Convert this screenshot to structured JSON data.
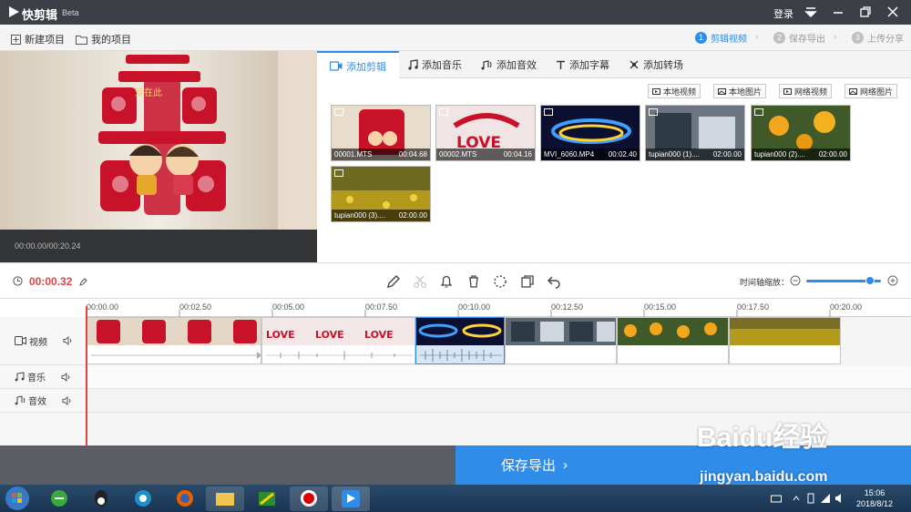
{
  "app": {
    "title": "快剪辑",
    "badge": "Beta",
    "login": "登录"
  },
  "toolbar": {
    "new_project": "新建项目",
    "my_projects": "我的项目"
  },
  "steps": [
    {
      "num": "1",
      "label": "剪辑视频"
    },
    {
      "num": "2",
      "label": "保存导出"
    },
    {
      "num": "3",
      "label": "上传分享"
    }
  ],
  "preview": {
    "time": "00:00.00/00:20.24"
  },
  "tabs": [
    {
      "label": "添加剪辑",
      "icon": "video-icon"
    },
    {
      "label": "添加音乐",
      "icon": "music-icon"
    },
    {
      "label": "添加音效",
      "icon": "sound-effect-icon"
    },
    {
      "label": "添加字幕",
      "icon": "text-icon"
    },
    {
      "label": "添加转场",
      "icon": "transition-icon"
    }
  ],
  "sources": [
    "本地视频",
    "本地图片",
    "网络视频",
    "网络图片"
  ],
  "media": [
    {
      "name": "00001.MTS",
      "duration": "00:04.68"
    },
    {
      "name": "00002.MTS",
      "duration": "00:04.16"
    },
    {
      "name": "MVI_6060.MP4",
      "duration": "00:02.40"
    },
    {
      "name": "tupian000 (1)....",
      "duration": "02:00.00"
    },
    {
      "name": "tupian000 (2)....",
      "duration": "02:00.00"
    },
    {
      "name": "tupian000 (3)....",
      "duration": "02:00.00"
    }
  ],
  "editbar": {
    "current_time": "00:00.32",
    "zoom_label": "时间轴缩放：",
    "zoom_level": 0.85
  },
  "ruler": [
    "00:00.00",
    "00:02.50",
    "00:05.00",
    "00:07.50",
    "00:10.00",
    "00:12.50",
    "00:15.00",
    "00:17.50",
    "00:20.00"
  ],
  "tracks": {
    "video": "视频",
    "music": "音乐",
    "sfx": "音效"
  },
  "export": {
    "label": "保存导出"
  },
  "watermark": {
    "brand": "Baidu经验",
    "url": "jingyan.baidu.com"
  },
  "clock": {
    "time": "15:06",
    "date": "2018/8/12"
  },
  "colors": {
    "accent": "#2f8ce8",
    "titlebar": "#3c3f45",
    "time": "#e04545"
  }
}
